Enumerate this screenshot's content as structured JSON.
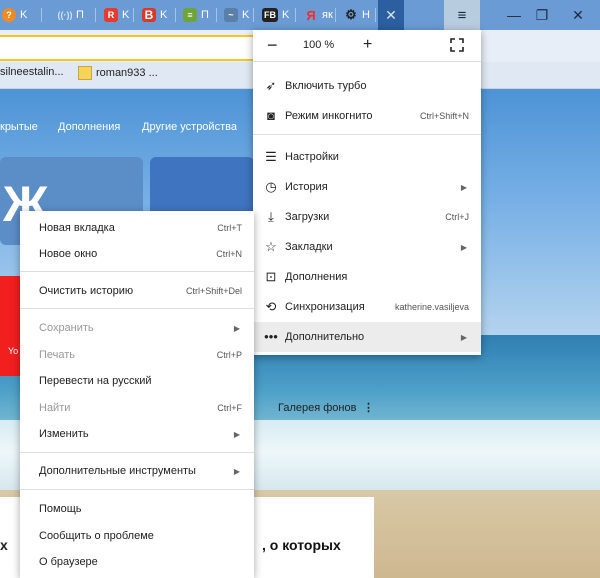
{
  "tabs": [
    {
      "label": "K",
      "icon": "k-icon",
      "color": "#f08a24"
    },
    {
      "label": "П",
      "icon": "antenna-icon",
      "color": "#4a88d8"
    },
    {
      "label": "K",
      "icon": "r-icon",
      "color": "#e63b2e"
    },
    {
      "label": "K",
      "icon": "b-icon",
      "color": "#d83a2a"
    },
    {
      "label": "П",
      "icon": "box-icon",
      "color": "#6fa43a"
    },
    {
      "label": "K",
      "icon": "bird-icon",
      "color": "#5a7fa8"
    },
    {
      "label": "K",
      "icon": "fb-icon",
      "color": "#222222"
    },
    {
      "label": "як",
      "icon": "yandex-icon",
      "color": "#e03030"
    },
    {
      "label": "Н",
      "icon": "gear-icon",
      "color": "#333333"
    }
  ],
  "bookmarks": [
    {
      "label": "silneestalin..."
    },
    {
      "label": "roman933 ..."
    }
  ],
  "page": {
    "nav": [
      "крытые",
      "Дополнения",
      "Другие устройства"
    ],
    "gallery": "Галерея фонов",
    "news_right": ", о которых",
    "news_left": "х",
    "tile_red_label": "Yo"
  },
  "main_menu": {
    "zoom": "100 %",
    "items": [
      {
        "label": "Включить турбо",
        "icon": "rocket-icon",
        "shortcut": ""
      },
      {
        "label": "Режим инкогнито",
        "icon": "incognito-icon",
        "shortcut": "Ctrl+Shift+N"
      },
      {
        "label": "Настройки",
        "icon": "settings-sliders-icon",
        "shortcut": ""
      },
      {
        "label": "История",
        "icon": "clock-icon",
        "shortcut": "",
        "submenu": true
      },
      {
        "label": "Загрузки",
        "icon": "download-icon",
        "shortcut": "Ctrl+J"
      },
      {
        "label": "Закладки",
        "icon": "star-icon",
        "shortcut": "",
        "submenu": true
      },
      {
        "label": "Дополнения",
        "icon": "extensions-icon",
        "shortcut": ""
      },
      {
        "label": "Синхронизация",
        "icon": "sync-icon",
        "shortcut": "katherine.vasiljeva"
      },
      {
        "label": "Дополнительно",
        "icon": "more-icon",
        "shortcut": "",
        "submenu": true
      }
    ]
  },
  "context_menu": {
    "items": [
      {
        "label": "Новая вкладка",
        "shortcut": "Ctrl+T"
      },
      {
        "label": "Новое окно",
        "shortcut": "Ctrl+N"
      },
      {
        "label": "Очистить историю",
        "shortcut": "Ctrl+Shift+Del"
      },
      {
        "label": "Сохранить",
        "shortcut": "",
        "disabled": true
      },
      {
        "label": "Печать",
        "shortcut": "Ctrl+P",
        "disabled": true
      },
      {
        "label": "Перевести на русский",
        "shortcut": ""
      },
      {
        "label": "Найти",
        "shortcut": "Ctrl+F",
        "disabled": true
      },
      {
        "label": "Изменить",
        "shortcut": ""
      },
      {
        "label": "Дополнительные инструменты",
        "shortcut": ""
      },
      {
        "label": "Помощь",
        "shortcut": ""
      },
      {
        "label": "Сообщить о проблеме",
        "shortcut": ""
      },
      {
        "label": "О браузере",
        "shortcut": ""
      }
    ]
  }
}
